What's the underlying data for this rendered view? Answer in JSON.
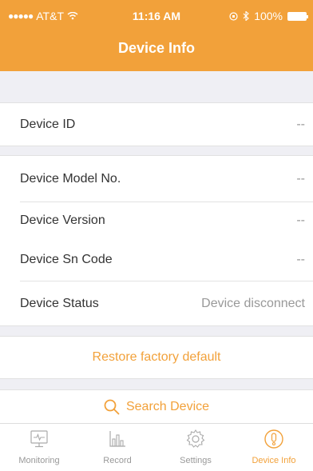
{
  "status_bar": {
    "carrier": "AT&T",
    "time": "11:16 AM",
    "battery": "100%"
  },
  "header": {
    "title": "Device Info"
  },
  "rows": {
    "device_id": {
      "label": "Device ID",
      "value": "--"
    },
    "model": {
      "label": "Device Model No.",
      "value": "--"
    },
    "version": {
      "label": "Device Version",
      "value": "--"
    },
    "sn": {
      "label": "Device Sn Code",
      "value": "--"
    },
    "status": {
      "label": "Device Status",
      "value": "Device disconnect"
    }
  },
  "actions": {
    "restore": "Restore factory default",
    "search": "Search Device"
  },
  "tabbar": {
    "tabs": [
      {
        "label": "Monitoring",
        "icon": "monitor-icon",
        "active": false
      },
      {
        "label": "Record",
        "icon": "bar-chart-icon",
        "active": false
      },
      {
        "label": "Settings",
        "icon": "gear-icon",
        "active": false
      },
      {
        "label": "Device Info",
        "icon": "info-alert-icon",
        "active": true
      }
    ]
  },
  "colors": {
    "accent": "#f2a13a",
    "background": "#efeff4",
    "muted": "#999999"
  }
}
